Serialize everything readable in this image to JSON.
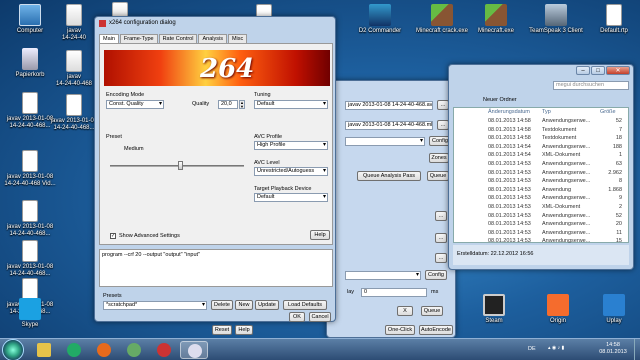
{
  "desktop_icons": [
    {
      "label": "Computer",
      "icon": "computer-icon"
    },
    {
      "label": "javav\n14-24-40",
      "icon": "exe-icon"
    },
    {
      "label": "20",
      "icon": "folder-icon"
    },
    {
      "label": "",
      "icon": "file-icon"
    },
    {
      "label": "Papierkorb",
      "icon": "recycle-bin-icon"
    },
    {
      "label": "javav\n14-24-40-468",
      "icon": "exe-icon"
    },
    {
      "label": "javav 2013-01-08\n14-24-40-468...",
      "icon": "doc-icon"
    },
    {
      "label": "javav 2013-01-08\n14-24-40-468...",
      "icon": "doc-icon"
    },
    {
      "label": "javav 2013-01-08\n14-24-40-468 Vid...",
      "icon": "doc-icon"
    },
    {
      "label": "javav 2013-01-08\n14-24-40-468...",
      "icon": "doc-icon"
    },
    {
      "label": "javav 2013-01-08\n14-24-40-468...",
      "icon": "doc-icon"
    },
    {
      "label": "javav 2013-01-08\n14-24-40-468...",
      "icon": "doc-icon"
    },
    {
      "label": "Skype",
      "icon": "skype-icon"
    },
    {
      "label": "DVD",
      "icon": "dvd-icon"
    },
    {
      "label": "DVD",
      "icon": "dvd-icon"
    },
    {
      "label": "D2 Commander",
      "icon": "d2-commander-icon"
    },
    {
      "label": "Minecraft crack.exe",
      "icon": "minecraft-icon"
    },
    {
      "label": "Minecraft.exe",
      "icon": "minecraft-icon"
    },
    {
      "label": "TeamSpeak 3 Client",
      "icon": "teamspeak-icon"
    },
    {
      "label": "Default.rtp",
      "icon": "file-icon"
    },
    {
      "label": "Steam",
      "icon": "steam-icon"
    },
    {
      "label": "Origin",
      "icon": "origin-icon"
    },
    {
      "label": "Uplay",
      "icon": "uplay-icon"
    }
  ],
  "x264": {
    "title": "x264 configuration dialog",
    "tabs": [
      "Main",
      "Frame-Type",
      "Rate Control",
      "Analysis",
      "Misc"
    ],
    "banner_text": "264",
    "encoding_mode_label": "Encoding Mode",
    "encoding_mode_value": "Const. Quality",
    "quality_label": "Quality",
    "quality_value": "20,0",
    "preset_label": "Preset",
    "preset_value": "Medium",
    "tuning_label": "Tuning",
    "tuning_value": "Default",
    "avc_profile_label": "AVC Profile",
    "avc_profile_value": "High Profile",
    "avc_level_label": "AVC Level",
    "avc_level_value": "Unrestricted/Autoguess",
    "playback_label": "Target Playback Device",
    "playback_value": "Default",
    "show_advanced": "Show Advanced Settings",
    "help": "Help",
    "cmdline": "program --crf 20 --output \"output\" \"input\"",
    "presets_label": "Presets",
    "presets_value": "*scratchpad*",
    "btn_delete": "Delete",
    "btn_new": "New",
    "btn_update": "Update",
    "btn_load_defaults": "Load Defaults",
    "btn_ok": "OK",
    "btn_cancel": "Cancel"
  },
  "megui": {
    "file1": "javav 2013-01-08 14-24-40-468.avs",
    "file2": "javav 2013-01-08 14-24-40-468.mkv",
    "btn_config": "Config",
    "btn_zones": "Zones",
    "btn_queue_analysis": "Queue Analysis Pass",
    "btn_queue": "Queue",
    "btn_config2": "Config",
    "delay_label": "lay",
    "delay_value": "0",
    "delay_unit": "ms",
    "btn_x": "X",
    "btn_queue2": "Queue",
    "btn_reset": "Reset",
    "btn_help": "Help",
    "btn_oneclick": "One-Click",
    "btn_autoencode": "AutoEncode"
  },
  "explorer": {
    "search_placeholder": "megui durchsuchen",
    "new_folder": "Neuer Ordner",
    "col_date": "Änderungsdatum",
    "col_type": "Typ",
    "col_size": "Größe",
    "rows": [
      {
        "date": "08.01.2013 14:58",
        "type": "Anwendungserwe...",
        "size": "52"
      },
      {
        "date": "08.01.2013 14:58",
        "type": "Textdokument",
        "size": "7"
      },
      {
        "date": "08.01.2013 14:58",
        "type": "Textdokument",
        "size": "18"
      },
      {
        "date": "08.01.2013 14:54",
        "type": "Anwendungserwe...",
        "size": "188"
      },
      {
        "date": "08.01.2013 14:54",
        "type": "XML-Dokument",
        "size": "1"
      },
      {
        "date": "08.01.2013 14:53",
        "type": "Anwendungserwe...",
        "size": "63"
      },
      {
        "date": "08.01.2013 14:53",
        "type": "Anwendungserwe...",
        "size": "2.962"
      },
      {
        "date": "08.01.2013 14:53",
        "type": "Anwendungserwe...",
        "size": "8"
      },
      {
        "date": "08.01.2013 14:53",
        "type": "Anwendung",
        "size": "1.868"
      },
      {
        "date": "08.01.2013 14:53",
        "type": "Anwendungserwe...",
        "size": "9"
      },
      {
        "date": "08.01.2013 14:53",
        "type": "XML-Dokument",
        "size": "2"
      },
      {
        "date": "08.01.2013 14:53",
        "type": "Anwendungserwe...",
        "size": "52"
      },
      {
        "date": "08.01.2013 14:53",
        "type": "Anwendungserwe...",
        "size": "20"
      },
      {
        "date": "08.01.2013 14:53",
        "type": "Anwendungserwe...",
        "size": "11"
      },
      {
        "date": "08.01.2013 14:53",
        "type": "Anwendungserwe...",
        "size": "15"
      }
    ],
    "status": "Erstelldatum: 22.12.2012 16:56"
  },
  "taskbar": {
    "lang": "DE",
    "time": "14:58",
    "date": "08.01.2013"
  }
}
